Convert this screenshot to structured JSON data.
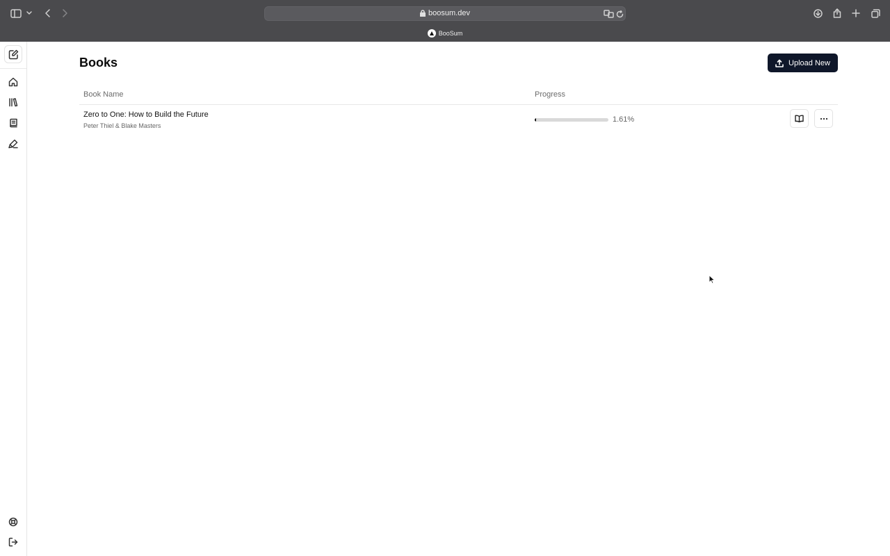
{
  "browser": {
    "url": "boosum.dev",
    "tab_title": "BooSum"
  },
  "sidebar": {
    "items": [
      {
        "name": "new-note",
        "icon": "note-edit-icon",
        "active": true
      },
      {
        "name": "home",
        "icon": "home-icon"
      },
      {
        "name": "library",
        "icon": "library-icon"
      },
      {
        "name": "books",
        "icon": "book-icon"
      },
      {
        "name": "highlights",
        "icon": "highlighter-icon"
      }
    ],
    "bottom": [
      {
        "name": "support",
        "icon": "lifebuoy-icon"
      },
      {
        "name": "logout",
        "icon": "logout-icon"
      }
    ]
  },
  "page": {
    "title": "Books",
    "upload_label": "Upload New"
  },
  "table": {
    "columns": [
      "Book Name",
      "Progress"
    ],
    "rows": [
      {
        "title": "Zero to One: How to Build the Future",
        "author": "Peter Thiel & Blake Masters",
        "progress_text": "1.61%",
        "progress_percent": 1.61
      }
    ]
  },
  "colors": {
    "primary_button": "#0f172a",
    "chrome": "#4a4a4d"
  }
}
